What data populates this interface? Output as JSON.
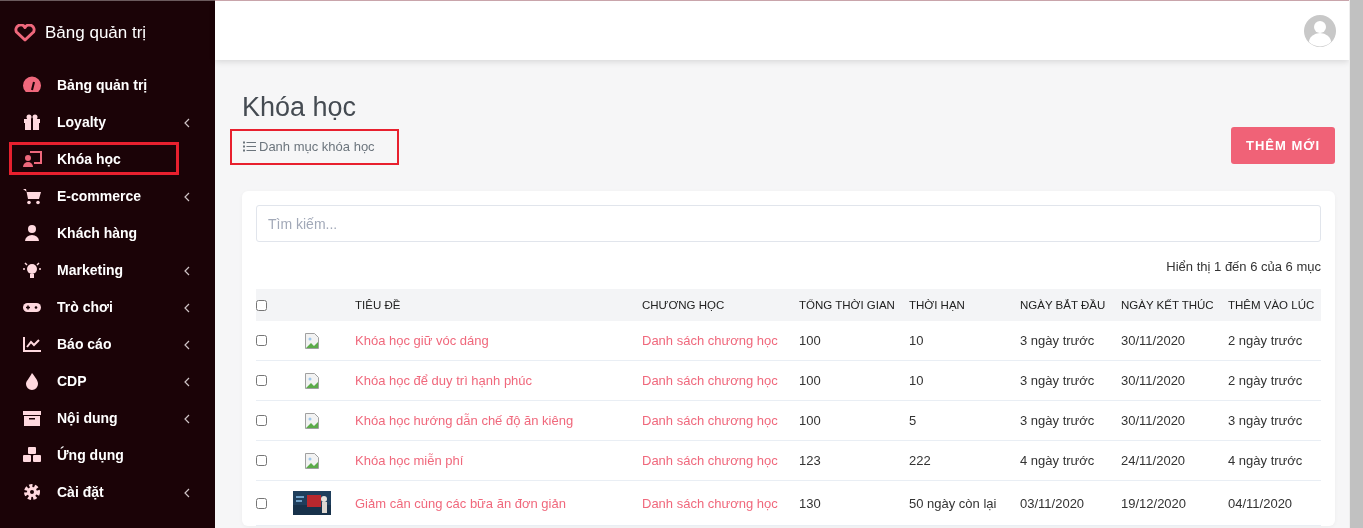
{
  "sidebar": {
    "brand": "Bảng quản trị",
    "items": [
      {
        "label": "Bảng quản trị",
        "selected": false,
        "has_submenu": false
      },
      {
        "label": "Loyalty",
        "selected": false,
        "has_submenu": true
      },
      {
        "label": "Khóa học",
        "selected": true,
        "has_submenu": false
      },
      {
        "label": "E-commerce",
        "selected": false,
        "has_submenu": true
      },
      {
        "label": "Khách hàng",
        "selected": false,
        "has_submenu": false
      },
      {
        "label": "Marketing",
        "selected": false,
        "has_submenu": true
      },
      {
        "label": "Trò chơi",
        "selected": false,
        "has_submenu": true
      },
      {
        "label": "Báo cáo",
        "selected": false,
        "has_submenu": true
      },
      {
        "label": "CDP",
        "selected": false,
        "has_submenu": true
      },
      {
        "label": "Nội dung",
        "selected": false,
        "has_submenu": true
      },
      {
        "label": "Ứng dụng",
        "selected": false,
        "has_submenu": false
      },
      {
        "label": "Cài đặt",
        "selected": false,
        "has_submenu": true
      }
    ]
  },
  "page": {
    "title": "Khóa học",
    "breadcrumb": {
      "label": "Danh mục khóa học",
      "highlighted": true
    },
    "add_button": "THÊM MỚI"
  },
  "search": {
    "placeholder": "Tìm kiếm..."
  },
  "summary": "Hiển thị 1 đến 6 của 6 mục",
  "table": {
    "columns": [
      "TIÊU ĐỀ",
      "CHƯƠNG HỌC",
      "TỔNG THỜI GIAN",
      "THỜI HẠN",
      "NGÀY BẮT ĐẦU",
      "NGÀY KẾT THÚC",
      "THÊM VÀO LÚC"
    ],
    "all_checked": false,
    "rows": [
      {
        "checked": false,
        "kind": "broken",
        "title": "Khóa học giữ vóc dáng",
        "chapters": "Danh sách chương học",
        "total_time": "100",
        "duration": "10",
        "start": "3 ngày trước",
        "end": "30/11/2020",
        "added": "2 ngày trước"
      },
      {
        "checked": false,
        "kind": "broken",
        "title": "Khóa học để duy trì hạnh phúc",
        "chapters": "Danh sách chương học",
        "total_time": "100",
        "duration": "10",
        "start": "3 ngày trước",
        "end": "30/11/2020",
        "added": "2 ngày trước"
      },
      {
        "checked": false,
        "kind": "broken",
        "title": "Khóa học hướng dẫn chế độ ăn kiêng",
        "chapters": "Danh sách chương học",
        "total_time": "100",
        "duration": "5",
        "start": "3 ngày trước",
        "end": "30/11/2020",
        "added": "3 ngày trước"
      },
      {
        "checked": false,
        "kind": "broken",
        "title": "Khóa học miễn phí",
        "chapters": "Danh sách chương học",
        "total_time": "123",
        "duration": "222",
        "start": "4 ngày trước",
        "end": "24/11/2020",
        "added": "4 ngày trước"
      },
      {
        "checked": false,
        "kind": "picture",
        "title": "Giảm cân cùng các bữa ăn đơn giản",
        "chapters": "Danh sách chương học",
        "total_time": "130",
        "duration": "50 ngày còn lại",
        "start": "03/11/2020",
        "end": "19/12/2020",
        "added": "04/11/2020"
      }
    ]
  }
}
